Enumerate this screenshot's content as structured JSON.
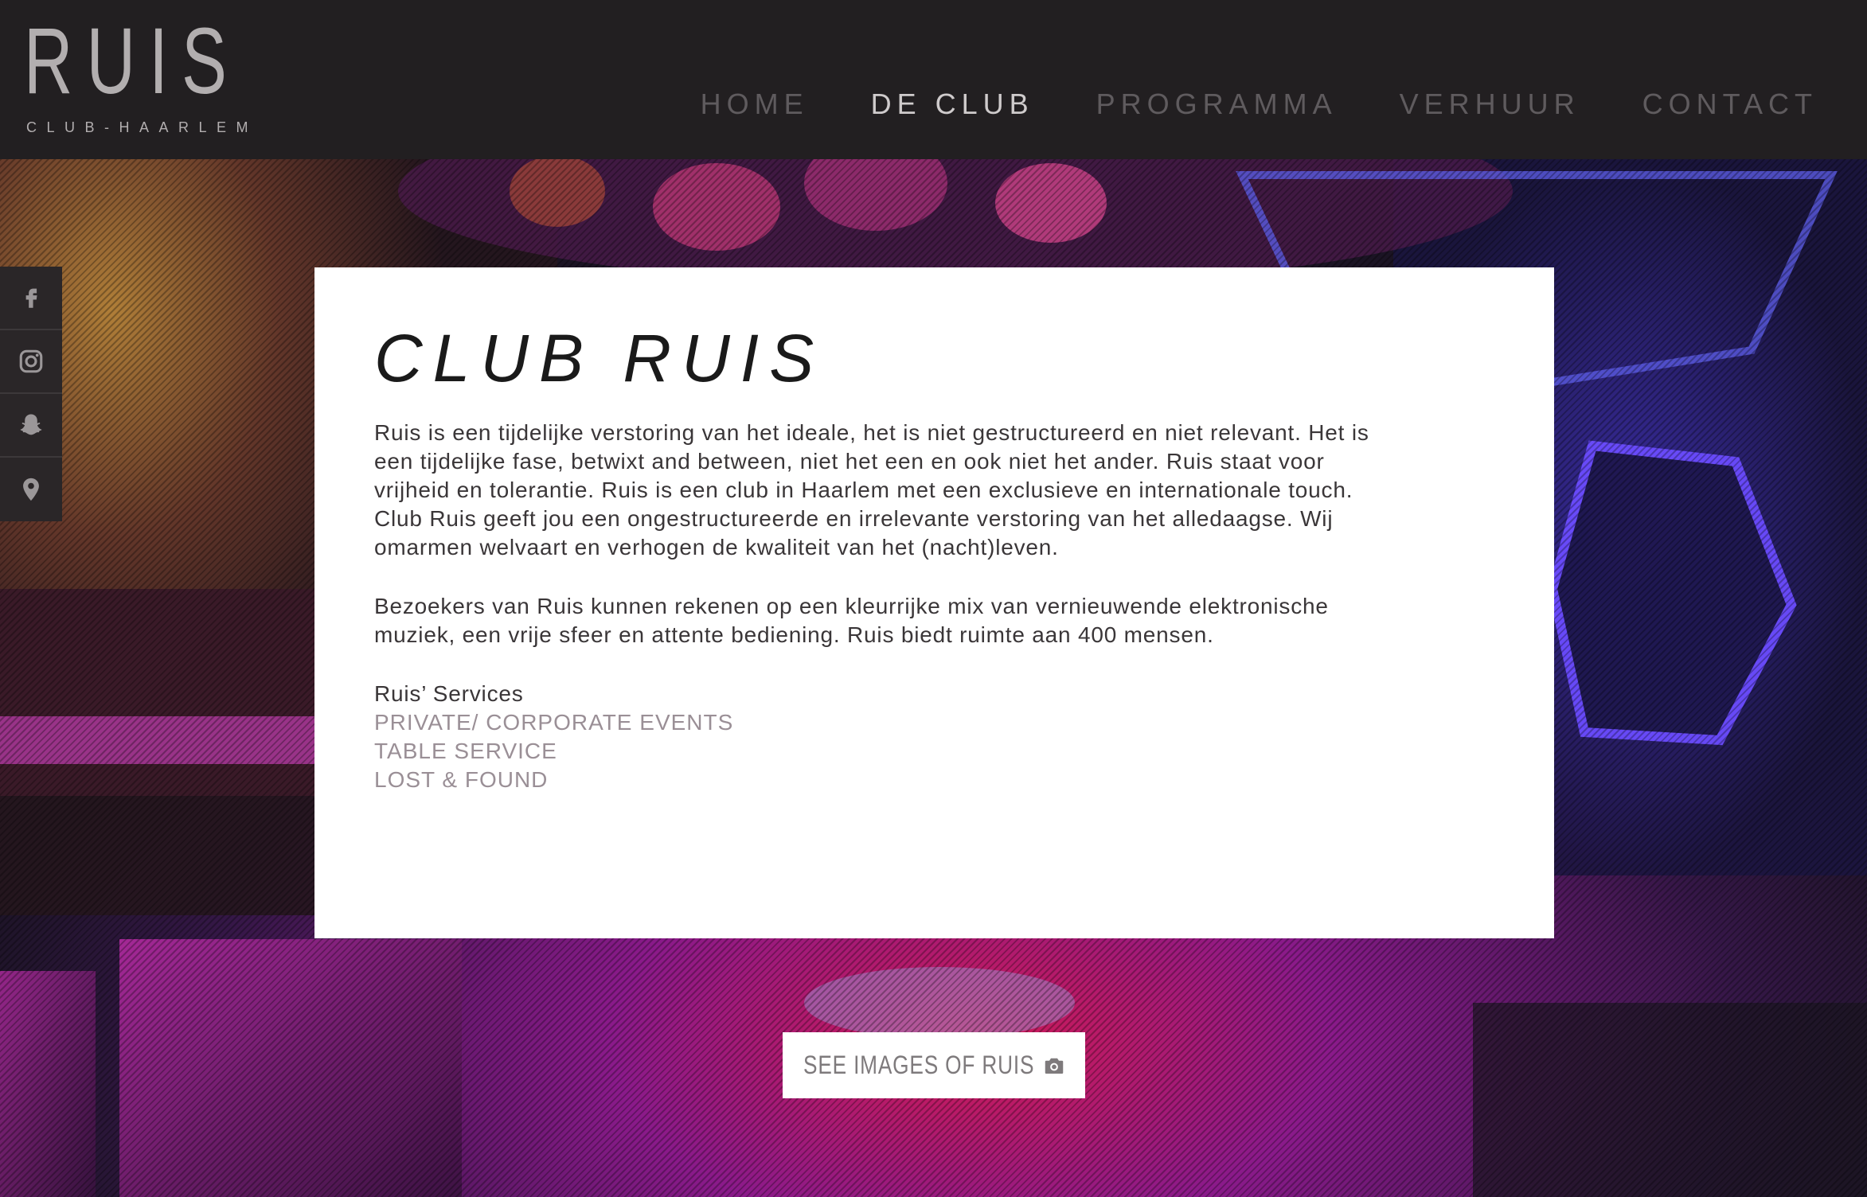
{
  "brand": {
    "name": "RUIS",
    "tagline": "CLUB-HAARLEM"
  },
  "nav": {
    "items": [
      {
        "label": "HOME",
        "active": false
      },
      {
        "label": "DE CLUB",
        "active": true
      },
      {
        "label": "PROGRAMMA",
        "active": false
      },
      {
        "label": "VERHUUR",
        "active": false
      },
      {
        "label": "CONTACT",
        "active": false
      }
    ]
  },
  "social": {
    "icons": [
      "facebook-icon",
      "instagram-icon",
      "snapchat-icon",
      "location-pin-icon"
    ]
  },
  "content": {
    "title": "CLUB RUIS",
    "paragraphs": [
      "Ruis is een tijdelijke verstoring van het ideale, het is niet gestructureerd en niet relevant. Het is een tijdelijke fase, betwixt and between, niet het een en ook niet het ander. Ruis staat voor vrijheid en tolerantie. Ruis is een club in Haarlem met een exclusieve en internationale touch. Club Ruis geeft jou een ongestructureerde en irrelevante verstoring van het alledaagse. Wij omarmen welvaart en verhogen de kwaliteit van het (nacht)leven.",
      "Bezoekers van Ruis kunnen rekenen op een kleurrijke mix van vernieuwende elektronische muziek, een vrije sfeer en attente bediening. Ruis biedt ruimte aan 400 mensen."
    ],
    "services_heading": "Ruis’ Services",
    "services": [
      "PRIVATE/ CORPORATE EVENTS",
      "TABLE SERVICE",
      "LOST & FOUND"
    ]
  },
  "gallery_button": {
    "label": "SEE IMAGES OF RUIS",
    "icon": "camera-icon"
  },
  "colors": {
    "header_bg": "#221f21",
    "nav_inactive": "#5f5b5e",
    "nav_active": "#cfcbcc",
    "link": "#9a8f96",
    "card_bg": "#ffffff"
  }
}
